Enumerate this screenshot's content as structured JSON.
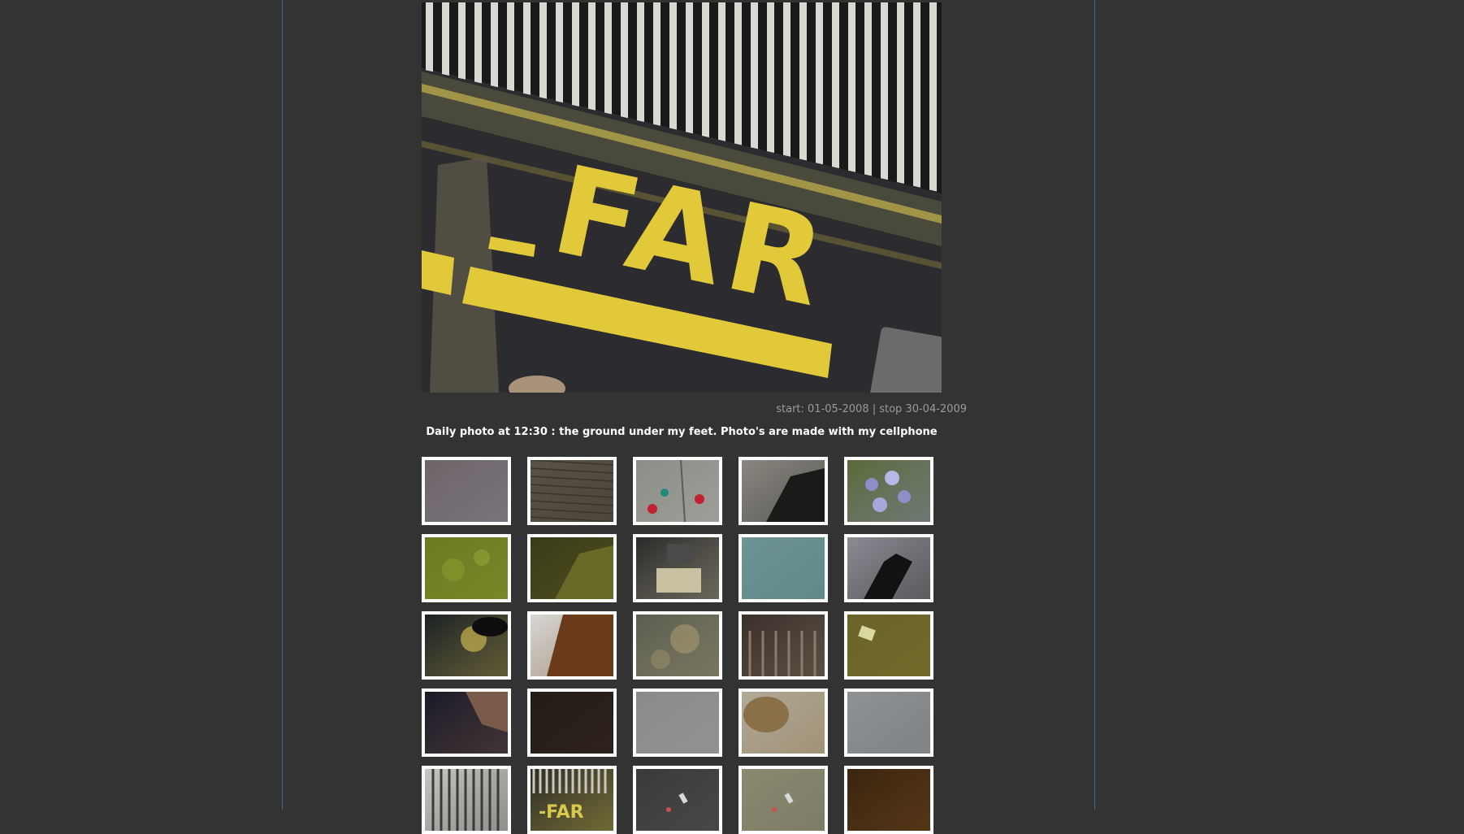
{
  "main_photo": {
    "alt": "daily photo",
    "painted_text": "FAR"
  },
  "dates": "start: 01-05-2008 | stop 30-04-2009",
  "description": "Daily photo at 12:30 : the ground under my feet. Photo's are made with my cellphone",
  "thumbnails": [
    {
      "name": "brown-floor"
    },
    {
      "name": "brick-pavement"
    },
    {
      "name": "flowers-on-tiles"
    },
    {
      "name": "shadow-on-pavement"
    },
    {
      "name": "purple-flowers"
    },
    {
      "name": "green-grass"
    },
    {
      "name": "bicycle-shadow"
    },
    {
      "name": "drawer-objects"
    },
    {
      "name": "blue-seat"
    },
    {
      "name": "black-shoe"
    },
    {
      "name": "cobblestones-leaves"
    },
    {
      "name": "rust-wall"
    },
    {
      "name": "dappled-pavement"
    },
    {
      "name": "escalator-steps"
    },
    {
      "name": "olive-floor"
    },
    {
      "name": "dark-hand"
    },
    {
      "name": "dark-surface"
    },
    {
      "name": "grey-concrete"
    },
    {
      "name": "rock-on-sand"
    },
    {
      "name": "wet-asphalt"
    },
    {
      "name": "drain-grate"
    },
    {
      "name": "far-grate"
    },
    {
      "name": "dark-asphalt-litter"
    },
    {
      "name": "gravel-bottle"
    },
    {
      "name": "brown-puddle"
    }
  ]
}
